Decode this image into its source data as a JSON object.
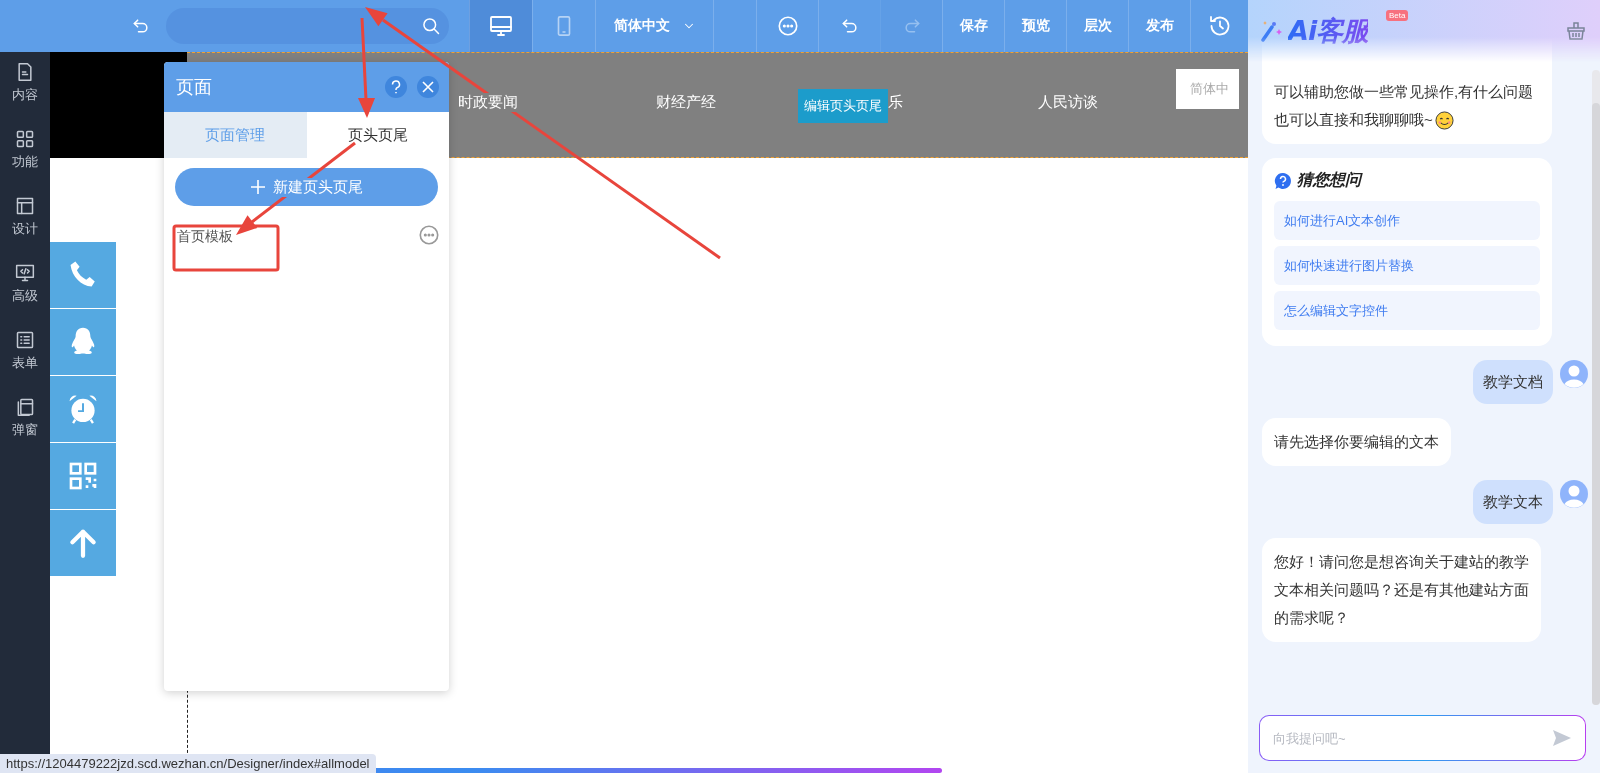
{
  "toolbar": {
    "device_tabs": [
      {
        "kind": "desktop",
        "selected": true
      },
      {
        "kind": "tablet",
        "selected": false
      }
    ],
    "language": "简体中文",
    "actions": [
      {
        "kind": "more",
        "disabled": false
      },
      {
        "kind": "undo",
        "disabled": false
      },
      {
        "kind": "redo",
        "disabled": true
      },
      {
        "kind": "text",
        "label": "保存",
        "disabled": false
      },
      {
        "kind": "text",
        "label": "预览",
        "disabled": false
      },
      {
        "kind": "text",
        "label": "层次",
        "disabled": false
      },
      {
        "kind": "text",
        "label": "发布",
        "disabled": false
      },
      {
        "kind": "history",
        "disabled": false
      }
    ]
  },
  "sidebar": {
    "items": [
      {
        "kind": "content",
        "label": "内容"
      },
      {
        "kind": "function",
        "label": "功能"
      },
      {
        "kind": "design",
        "label": "设计"
      },
      {
        "kind": "advanced",
        "label": "高级"
      },
      {
        "kind": "form",
        "label": "表单"
      },
      {
        "kind": "popup",
        "label": "弹窗"
      }
    ]
  },
  "canvas": {
    "nav": [
      "时政要闻",
      "财经产经",
      "乐",
      "人民访谈"
    ],
    "edit_button": "编辑页头页尾",
    "language_box": "简体中"
  },
  "float_buttons": [
    {
      "kind": "phone"
    },
    {
      "kind": "penguin"
    },
    {
      "kind": "alarm"
    },
    {
      "kind": "qr"
    },
    {
      "kind": "top"
    }
  ],
  "panel": {
    "title": "页面",
    "tabs": [
      {
        "label": "页面管理",
        "selected": false
      },
      {
        "label": "页头页尾",
        "selected": true
      }
    ],
    "new_button": "新建页头页尾",
    "items": [
      {
        "label": "首页模板"
      }
    ]
  },
  "chat": {
    "title": "Ai客服",
    "badge": "Beta",
    "messages": [
      {
        "kind": "bot",
        "lines": [
          "可以辅助您做一些常见操作,有什么问题",
          "也可以直接和我聊聊哦~"
        ],
        "smiley": true,
        "cut": true
      },
      {
        "kind": "suggestions",
        "title": "猜您想问",
        "items": [
          "如何进行AI文本创作",
          "如何快速进行图片替换",
          "怎么编辑文字控件"
        ]
      },
      {
        "kind": "user",
        "lines": [
          "教学文档"
        ]
      },
      {
        "kind": "bot",
        "lines": [
          "请先选择你要编辑的文本"
        ]
      },
      {
        "kind": "user",
        "lines": [
          "教学文本"
        ]
      },
      {
        "kind": "bot",
        "lines": [
          "您好！请问您是想咨询关于建站的教学",
          "文本相关问题吗？还是有其他建站方面",
          "的需求呢？"
        ]
      }
    ],
    "input": {
      "placeholder": "向我提问吧~"
    }
  },
  "status_url": "https://1204479222jzd.scd.wezhan.cn/Designer/index#allmodel",
  "loading_bar": {
    "level": 0.755
  }
}
